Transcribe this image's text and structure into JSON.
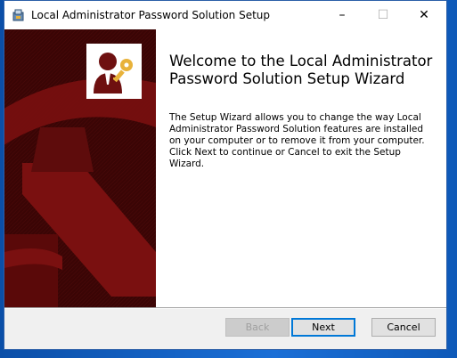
{
  "window": {
    "title": "Local Administrator Password Solution Setup",
    "minimize_glyph": "–",
    "maximize_glyph": "☐",
    "close_glyph": "✕"
  },
  "welcome": {
    "title": "Welcome to the Local Administrator Password Solution Setup Wizard",
    "body": "The Setup Wizard allows you to change the way Local Administrator Password Solution features are installed on your computer or to remove it from your computer. Click Next to continue or Cancel to exit the Setup Wizard."
  },
  "buttons": {
    "back": "Back",
    "next": "Next",
    "cancel": "Cancel"
  },
  "icons": {
    "app": "installer-icon",
    "logo": "admin-key-icon"
  },
  "colors": {
    "banner_dark": "#3a0505",
    "banner_red": "#7a1010",
    "accent": "#0078d7",
    "key": "#e8b23a"
  }
}
